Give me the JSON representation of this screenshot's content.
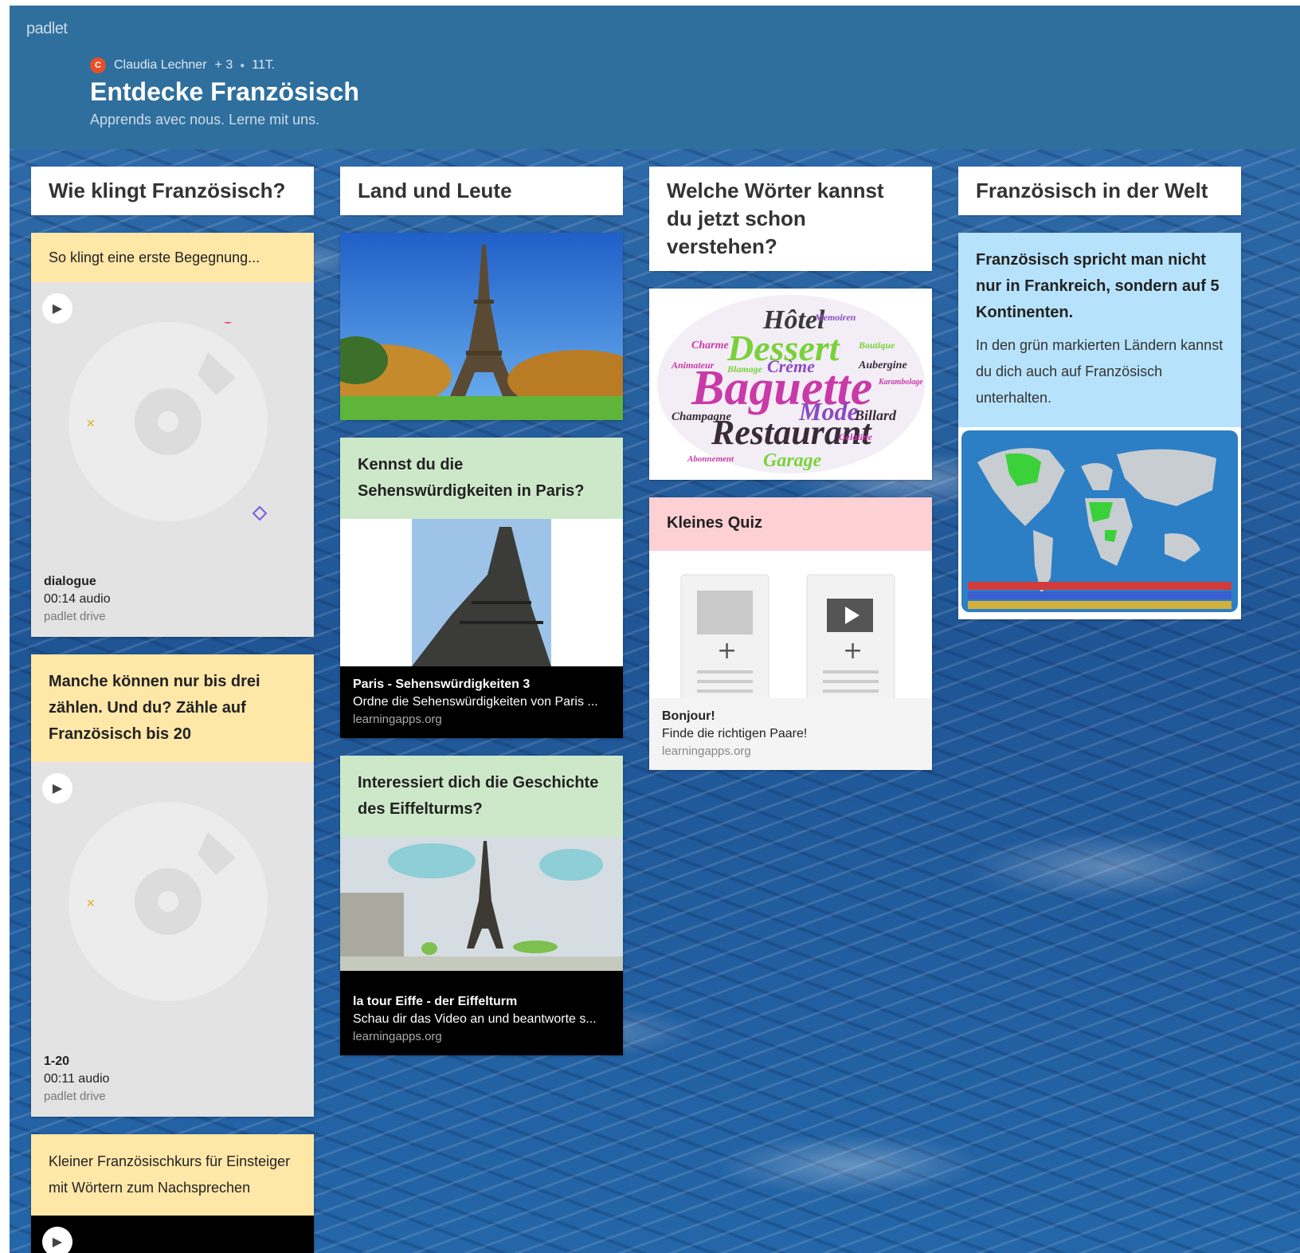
{
  "app": {
    "logo": "padlet"
  },
  "header": {
    "author_initial": "C",
    "author": "Claudia Lechner",
    "contributors": "+ 3",
    "age": "11T.",
    "title": "Entdecke Französisch",
    "subtitle": "Apprends avec nous. Lerne mit uns."
  },
  "columns": [
    {
      "title": "Wie klingt Französisch?",
      "posts": [
        {
          "text": "So klingt eine erste Begegnung...",
          "attachment": {
            "title": "dialogue",
            "detail": "00:14 audio",
            "source": "padlet drive"
          }
        },
        {
          "text": "Manche können nur bis drei zählen. Und du? Zähle auf Französisch bis 20",
          "attachment": {
            "title": "1-20",
            "detail": "00:11 audio",
            "source": "padlet drive"
          }
        },
        {
          "text": "Kleiner Französischkurs für Einsteiger mit Wörtern zum Nachsprechen"
        }
      ]
    },
    {
      "title": "Land und Leute",
      "posts": [
        {
          "image": "eiffel-tower-photo"
        },
        {
          "text": "Kennst du die Sehenswürdigkeiten in Paris?",
          "attachment": {
            "title": "Paris - Sehenswürdigkeiten 3",
            "detail": "Ordne die Sehenswürdigkeiten von Paris ...",
            "source": "learningapps.org"
          }
        },
        {
          "text": "Interessiert dich die Geschichte des Eiffelturms?",
          "attachment": {
            "title": "la tour Eiffe - der Eiffelturm",
            "detail": "Schau dir das Video an und beantworte s...",
            "source": "learningapps.org"
          }
        }
      ]
    },
    {
      "title": "Welche Wörter kannst du jetzt schon verstehen?",
      "posts": [
        {
          "wordcloud": [
            "Hôtel",
            "Dessert",
            "Baguette",
            "Restaurant",
            "Mode",
            "Crème",
            "Billard",
            "Garage",
            "Champagne",
            "Charme",
            "Blamage",
            "Aubergine",
            "Boutique",
            "Gelatine",
            "Animateur",
            "Abonnement",
            "Memoiren",
            "Karambolage"
          ]
        },
        {
          "text": "Kleines Quiz",
          "attachment": {
            "title": "Bonjour!",
            "detail": "Finde die richtigen Paare!",
            "source": "learningapps.org"
          }
        }
      ]
    },
    {
      "title": "Französisch in der Welt",
      "posts": [
        {
          "text": "Französisch spricht man nicht nur in Frankreich, sondern auf 5 Kontinenten.",
          "body": "In den grün markierten Ländern kannst du dich auch auf Französisch unterhalten.",
          "image": "world-map"
        }
      ]
    }
  ],
  "colors": {
    "header": "#2f6f9e",
    "yellow": "#ffe7a8",
    "green": "#cde8c9",
    "pink": "#fdd0d4",
    "blue": "#b7e2fb"
  }
}
